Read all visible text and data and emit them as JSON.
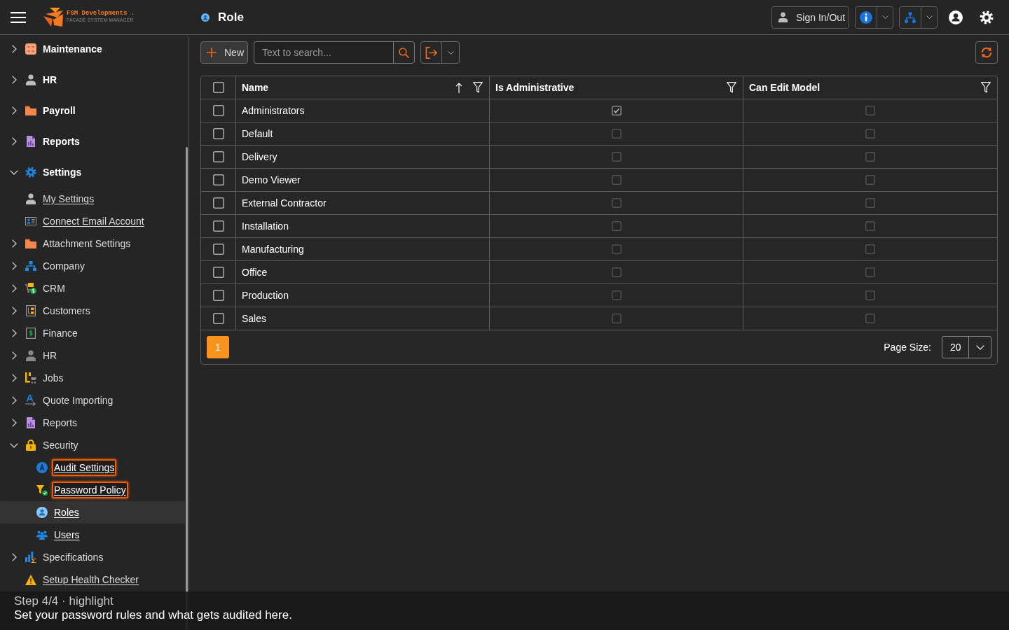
{
  "header": {
    "brand": "FSM Developments .",
    "tagline": "FACADE SYSTEM MANAGER",
    "title": "Role",
    "sign_in_out": "Sign In/Out"
  },
  "sidebar": {
    "items": [
      {
        "label": "Maintenance",
        "kind": "group",
        "expanded": false,
        "selected": false,
        "highlighted": false
      },
      {
        "label": "HR",
        "kind": "group",
        "expanded": false,
        "selected": false,
        "highlighted": false
      },
      {
        "label": "Payroll",
        "kind": "group",
        "expanded": false,
        "selected": false,
        "highlighted": false
      },
      {
        "label": "Reports",
        "kind": "group",
        "expanded": false,
        "selected": false,
        "highlighted": false
      },
      {
        "label": "Settings",
        "kind": "group",
        "expanded": true,
        "selected": false,
        "highlighted": false,
        "children": [
          {
            "label": "My Settings",
            "kind": "link",
            "selected": false,
            "highlighted": false
          },
          {
            "label": "Connect Email Account",
            "kind": "link",
            "selected": false,
            "highlighted": false
          },
          {
            "label": "Attachment Settings",
            "kind": "group",
            "expanded": false,
            "selected": false,
            "highlighted": false
          },
          {
            "label": "Company",
            "kind": "group",
            "expanded": false,
            "selected": false,
            "highlighted": false
          },
          {
            "label": "CRM",
            "kind": "group",
            "expanded": false,
            "selected": false,
            "highlighted": false
          },
          {
            "label": "Customers",
            "kind": "group",
            "expanded": false,
            "selected": false,
            "highlighted": false
          },
          {
            "label": "Finance",
            "kind": "group",
            "expanded": false,
            "selected": false,
            "highlighted": false
          },
          {
            "label": "HR",
            "kind": "group",
            "expanded": false,
            "selected": false,
            "highlighted": false
          },
          {
            "label": "Jobs",
            "kind": "group",
            "expanded": false,
            "selected": false,
            "highlighted": false
          },
          {
            "label": "Quote Importing",
            "kind": "group",
            "expanded": false,
            "selected": false,
            "highlighted": false
          },
          {
            "label": "Reports",
            "kind": "group",
            "expanded": false,
            "selected": false,
            "highlighted": false
          },
          {
            "label": "Security",
            "kind": "group",
            "expanded": true,
            "selected": false,
            "highlighted": false,
            "children": [
              {
                "label": "Audit Settings",
                "kind": "link",
                "selected": false,
                "highlighted": true
              },
              {
                "label": "Password Policy",
                "kind": "link",
                "selected": false,
                "highlighted": true
              },
              {
                "label": "Roles",
                "kind": "link",
                "selected": true,
                "highlighted": false
              },
              {
                "label": "Users",
                "kind": "link",
                "selected": false,
                "highlighted": false
              }
            ]
          },
          {
            "label": "Specifications",
            "kind": "group",
            "expanded": false,
            "selected": false,
            "highlighted": false
          },
          {
            "label": "Setup Health Checker",
            "kind": "link",
            "selected": false,
            "highlighted": false
          }
        ]
      }
    ]
  },
  "toolbar": {
    "new": "New",
    "search": {
      "placeholder": "Text to search..."
    }
  },
  "table": {
    "all_selected": false,
    "columns": [
      {
        "label": "Name",
        "kind": "text",
        "sorted": true
      },
      {
        "label": "Is Administrative",
        "kind": "check",
        "sorted": false
      },
      {
        "label": "Can Edit Model",
        "kind": "check",
        "sorted": false
      }
    ],
    "rows": [
      {
        "selected": false,
        "cells": [
          "Administrators",
          true,
          false
        ]
      },
      {
        "selected": false,
        "cells": [
          "Default",
          false,
          false
        ]
      },
      {
        "selected": false,
        "cells": [
          "Delivery",
          false,
          false
        ]
      },
      {
        "selected": false,
        "cells": [
          "Demo Viewer",
          false,
          false
        ]
      },
      {
        "selected": false,
        "cells": [
          "External Contractor",
          false,
          false
        ]
      },
      {
        "selected": false,
        "cells": [
          "Installation",
          false,
          false
        ]
      },
      {
        "selected": false,
        "cells": [
          "Manufacturing",
          false,
          false
        ]
      },
      {
        "selected": false,
        "cells": [
          "Office",
          false,
          false
        ]
      },
      {
        "selected": false,
        "cells": [
          "Production",
          false,
          false
        ]
      },
      {
        "selected": false,
        "cells": [
          "Sales",
          false,
          false
        ]
      }
    ]
  },
  "pager": {
    "pages": [
      {
        "label": "1",
        "selected": true
      }
    ],
    "page_size_label": "Page Size:",
    "page_size": "20"
  },
  "tour": {
    "step": "Step 4/4 · highlight",
    "message": "Set your password rules and what gets audited here."
  }
}
